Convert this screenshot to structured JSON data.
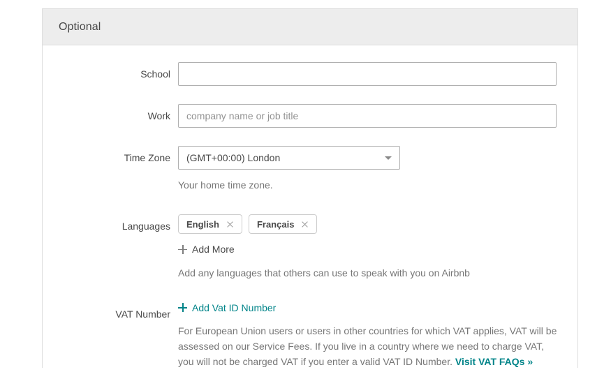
{
  "panel": {
    "header_title": "Optional"
  },
  "form": {
    "school": {
      "label": "School",
      "value": "",
      "placeholder": ""
    },
    "work": {
      "label": "Work",
      "value": "",
      "placeholder": "company name or job title"
    },
    "time_zone": {
      "label": "Time Zone",
      "selected": "(GMT+00:00) London",
      "helper": "Your home time zone.",
      "caret_icon": "chevron-down-icon"
    },
    "languages": {
      "label": "Languages",
      "chips": [
        {
          "label": "English",
          "remove_icon": "close-icon"
        },
        {
          "label": "Français",
          "remove_icon": "close-icon"
        }
      ],
      "add_more_label": "Add More",
      "add_more_icon": "plus-icon",
      "helper": "Add any languages that others can use to speak with you on Airbnb"
    },
    "vat": {
      "label": "VAT Number",
      "add_label": "Add Vat ID Number",
      "add_icon": "plus-icon",
      "description": "For European Union users or users in other countries for which VAT applies, VAT will be assessed on our Service Fees. If you live in a country where we need to charge VAT, you will not be charged VAT if you enter a valid VAT ID Number. ",
      "faq_link_label": "Visit VAT FAQs »"
    }
  },
  "colors": {
    "accent_teal": "#008489",
    "text_primary": "#484848",
    "text_muted": "#767676",
    "panel_header_bg": "#ededed",
    "border": "#dddddd",
    "input_border": "#b0b0b0"
  }
}
